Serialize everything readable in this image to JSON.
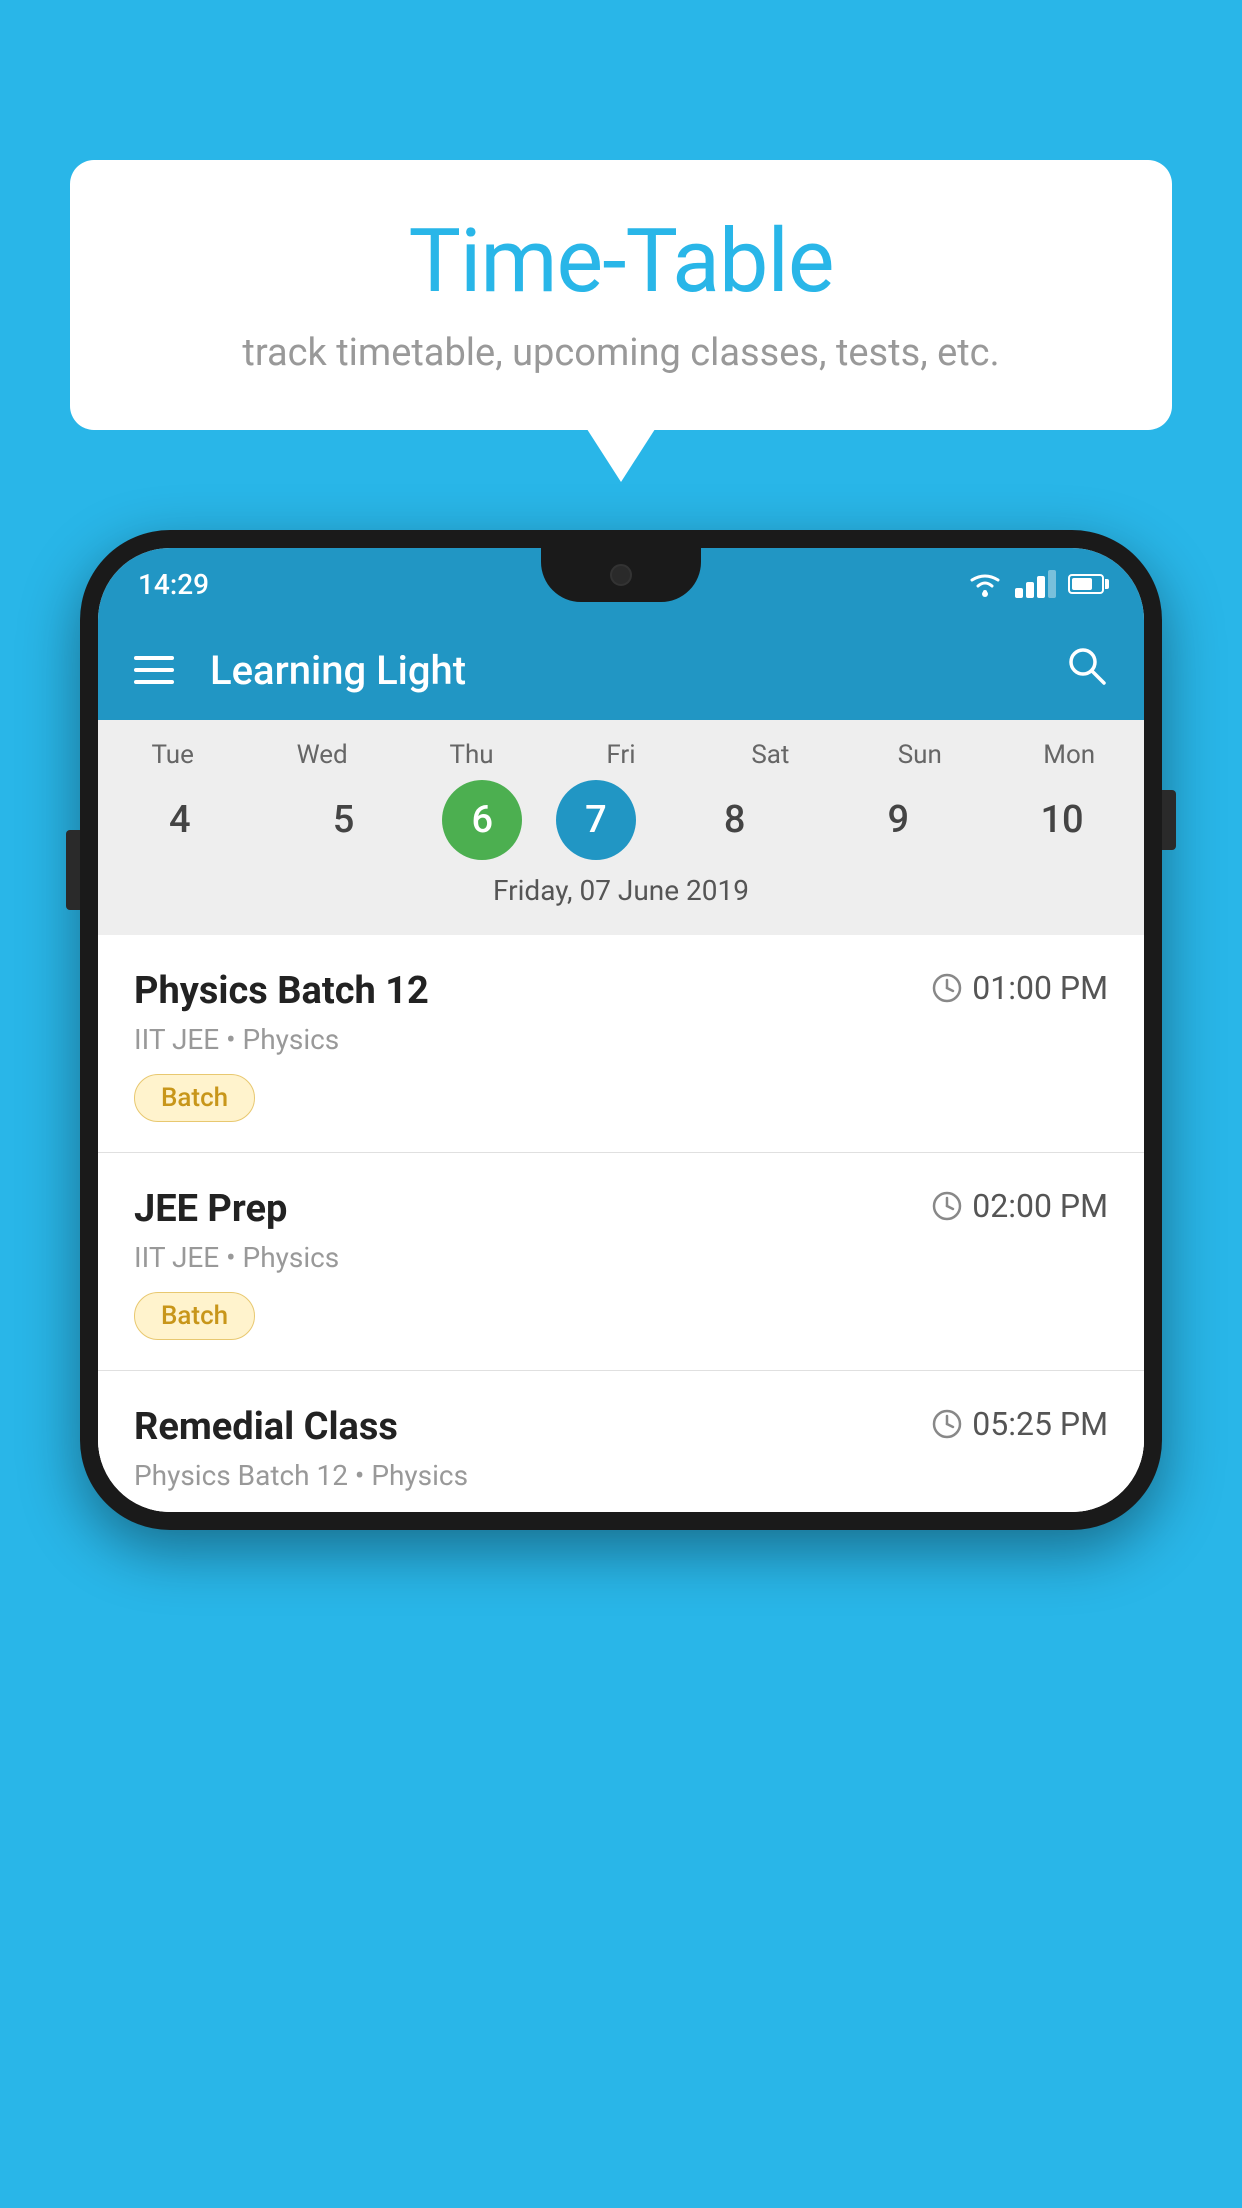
{
  "background_color": "#29B6E8",
  "speech_bubble": {
    "title": "Time-Table",
    "subtitle": "track timetable, upcoming classes, tests, etc."
  },
  "phone": {
    "status_bar": {
      "time": "14:29"
    },
    "toolbar": {
      "title": "Learning Light"
    },
    "calendar": {
      "days": [
        {
          "abbr": "Tue",
          "num": "4"
        },
        {
          "abbr": "Wed",
          "num": "5"
        },
        {
          "abbr": "Thu",
          "num": "6",
          "state": "today"
        },
        {
          "abbr": "Fri",
          "num": "7",
          "state": "selected"
        },
        {
          "abbr": "Sat",
          "num": "8"
        },
        {
          "abbr": "Sun",
          "num": "9"
        },
        {
          "abbr": "Mon",
          "num": "10"
        }
      ],
      "selected_date_label": "Friday, 07 June 2019"
    },
    "schedule": [
      {
        "title": "Physics Batch 12",
        "time": "01:00 PM",
        "subtitle": "IIT JEE • Physics",
        "badge": "Batch"
      },
      {
        "title": "JEE Prep",
        "time": "02:00 PM",
        "subtitle": "IIT JEE • Physics",
        "badge": "Batch"
      },
      {
        "title": "Remedial Class",
        "time": "05:25 PM",
        "subtitle": "Physics Batch 12 • Physics",
        "badge": null,
        "partial": true
      }
    ]
  }
}
